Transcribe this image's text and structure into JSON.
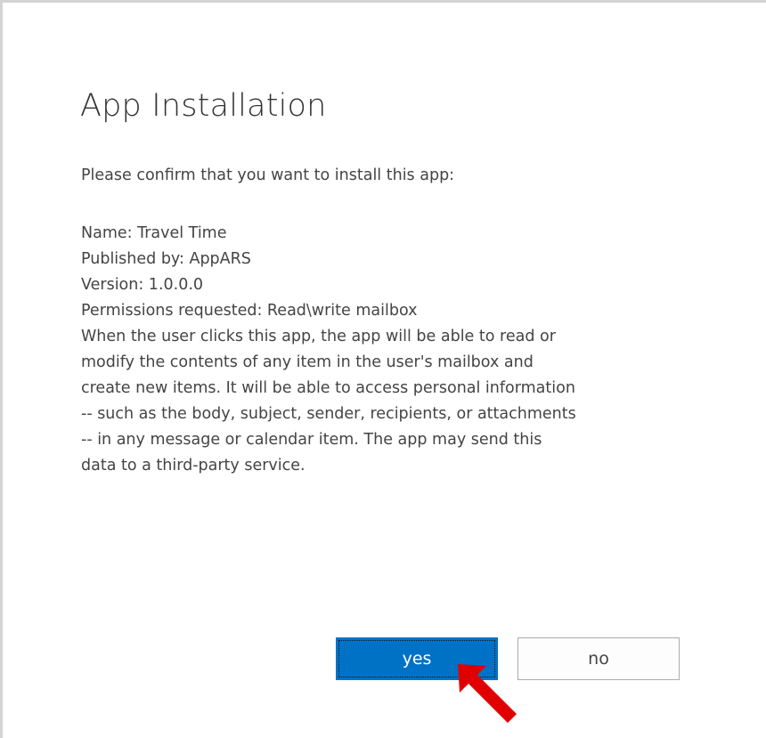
{
  "dialog": {
    "title": "App Installation",
    "confirm_text": "Please confirm that you want to install this app:",
    "details": [
      "Name: Travel Time",
      "Published by: AppARS",
      "Version: 1.0.0.0",
      "Permissions requested: Read\\write mailbox",
      "When the user clicks this app, the app will be able to read or",
      "modify the contents of any item in the user's mailbox and",
      "create new items. It will be able to access personal information",
      "-- such as the body, subject, sender, recipients, or attachments",
      "-- in any message or calendar item. The app may send this",
      "data to a third-party service."
    ],
    "yes_label": "yes",
    "no_label": "no"
  },
  "colors": {
    "primary_button": "#0072c6",
    "annotation_arrow": "#e00000"
  },
  "icons": {
    "annotation": "red-arrow-icon"
  }
}
